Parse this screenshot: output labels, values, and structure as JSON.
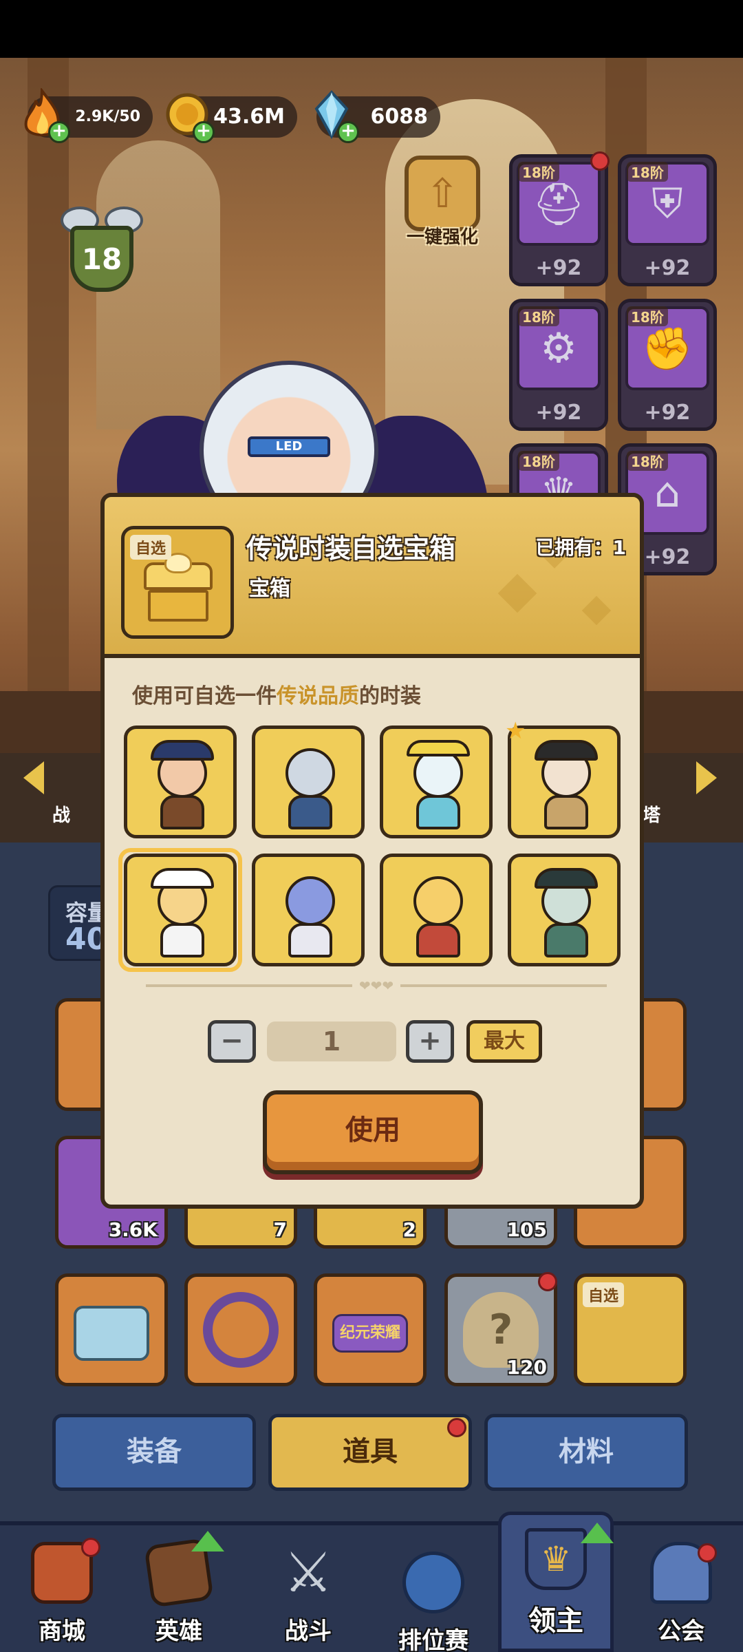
{
  "resources": {
    "energy": "2.9K/50",
    "gold": "43.6M",
    "gems": "6088"
  },
  "player": {
    "level": "18"
  },
  "enhance": {
    "label": "一键强化"
  },
  "equipment": [
    {
      "tier": "18阶",
      "bonus": "+92",
      "icon": "helmet-icon",
      "alert": true
    },
    {
      "tier": "18阶",
      "bonus": "+92",
      "icon": "armor-icon",
      "alert": false
    },
    {
      "tier": "18阶",
      "bonus": "+92",
      "icon": "boots-icon",
      "alert": false
    },
    {
      "tier": "18阶",
      "bonus": "+92",
      "icon": "gauntlet-icon",
      "alert": false
    },
    {
      "tier": "18阶",
      "bonus": "",
      "icon": "crown-icon",
      "alert": false
    },
    {
      "tier": "18阶",
      "bonus": "+92",
      "icon": "pants-icon",
      "alert": false
    }
  ],
  "side_labels": {
    "left": "战",
    "right": "塔"
  },
  "inventory": {
    "capacity_label": "容量",
    "capacity_value": "40",
    "counts": [
      "3.6K",
      "7",
      "2",
      "105",
      "120"
    ],
    "self_select_tag": "自选",
    "anniversary_label": "纪元荣耀"
  },
  "tabs": {
    "equipment": "装备",
    "items": "道具",
    "materials": "材料"
  },
  "nav": {
    "shop": "商城",
    "heroes": "英雄",
    "battle": "战斗",
    "ranked": "排位赛",
    "lord": "领主",
    "guild": "公会"
  },
  "dialog": {
    "tag": "自选",
    "title": "传说时装自选宝箱",
    "subtitle": "宝箱",
    "owned": "已拥有：1",
    "desc_prefix": "使用可自选一件",
    "desc_highlight": "传说品质",
    "desc_suffix": "的时装",
    "quantity": "1",
    "minus": "−",
    "plus": "+",
    "max": "最大",
    "use": "使用",
    "divider_hearts": "❤❤❤"
  },
  "colors": {
    "gold_panel": "#e2b74a",
    "dialog_bg": "#ece1c9",
    "use_button": "#e7963e",
    "nav_bg": "#2a3550",
    "alert_red": "#d93b3b"
  }
}
